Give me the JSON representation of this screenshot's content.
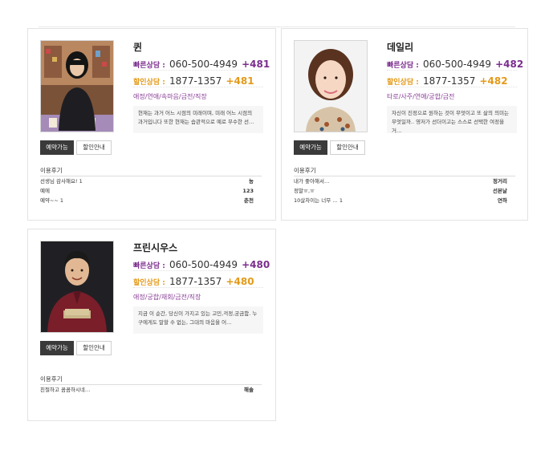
{
  "labels": {
    "fast": "빠른상담 :",
    "discount": "할인상담 :",
    "available": "예약가능",
    "discount_info": "할인안내",
    "reviews": "이용후기"
  },
  "cards": [
    {
      "name": "퀸",
      "fast_number": "060-500-4949",
      "fast_ext": "+481",
      "discount_number": "1877-1357",
      "discount_ext": "+481",
      "tags": "애정/연애/속마음/금전/직장",
      "desc": "현재는 과거 어느 시점의 미래이며, 미래 어느 시점의 과거입니다 또한 현재는 습관적으로 예로 무수한 선…",
      "reviews": [
        {
          "text": "선생님 감사해요! 1",
          "author": "농"
        },
        {
          "text": "예에",
          "author": "123"
        },
        {
          "text": "예약~~ 1",
          "author": "춘천"
        }
      ]
    },
    {
      "name": "데일리",
      "fast_number": "060-500-4949",
      "fast_ext": "+482",
      "discount_number": "1877-1357",
      "discount_ext": "+482",
      "tags": "타로/사주/연애/궁합/금전",
      "desc": "자신이 진정으로 원하는 것이 무엇이고 또 삶의 의미는 무엇일까.. 영저가 선더이고는 스스로 선택한 여정을 거…",
      "reviews": [
        {
          "text": "내가 좋아해서…",
          "author": "정거리"
        },
        {
          "text": "정말ㅠ,ㅠ",
          "author": "선본날"
        },
        {
          "text": "10살차이는 너무 … 1",
          "author": "연하"
        }
      ]
    },
    {
      "name": "프린시우스",
      "fast_number": "060-500-4949",
      "fast_ext": "+480",
      "discount_number": "1877-1357",
      "discount_ext": "+480",
      "tags": "애정/궁합/재회/금전/직장",
      "desc": "지금 이 순간, 당신이 가지고 있는 고민,걱정,궁금함. 누구에게도 말할 수 없는, 그대의 마음을 어…",
      "reviews": [
        {
          "text": "친절하고 꼼꼼하시네…",
          "author": "해솔"
        }
      ]
    }
  ]
}
